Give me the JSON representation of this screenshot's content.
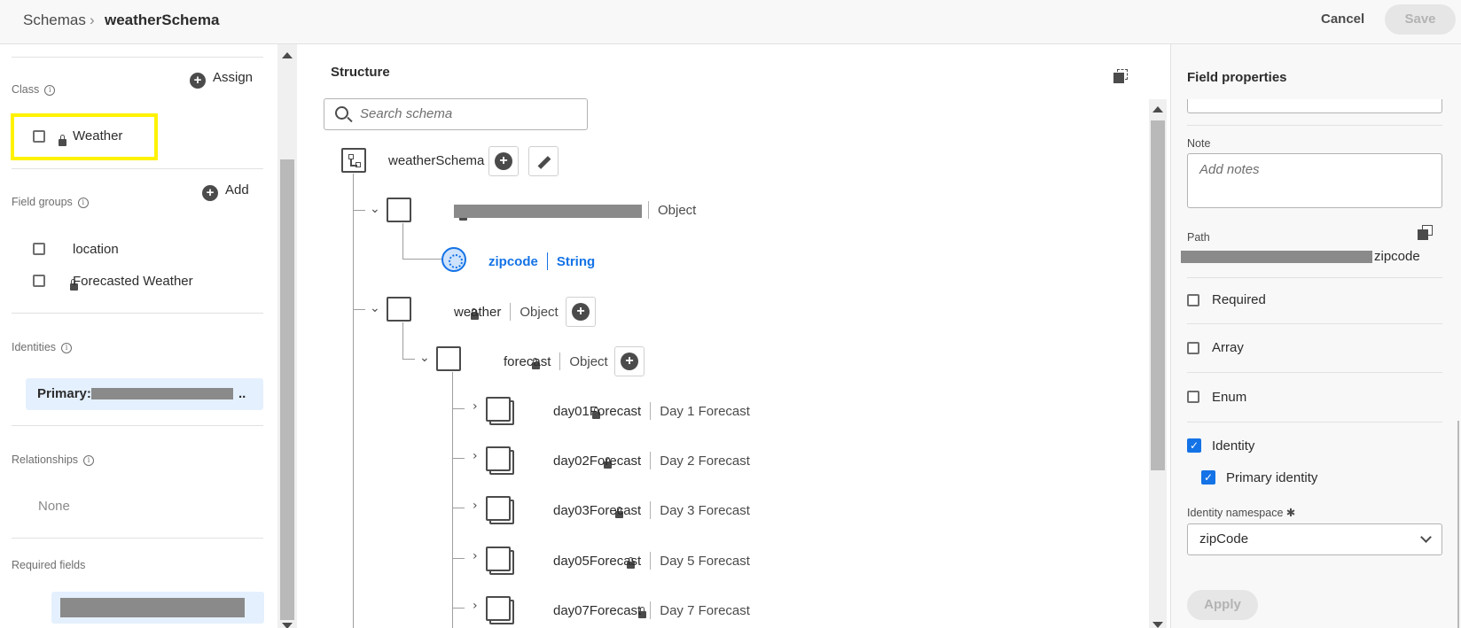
{
  "header": {
    "breadcrumb_root": "Schemas",
    "breadcrumb_separator": "›",
    "breadcrumb_current": "weatherSchema",
    "cancel_label": "Cancel",
    "save_label": "Save"
  },
  "left": {
    "class_label": "Class",
    "assign_label": "Assign",
    "class_item": "Weather",
    "field_groups_label": "Field groups",
    "add_label": "Add",
    "field_groups": [
      "location",
      "Forecasted Weather"
    ],
    "identities_label": "Identities",
    "identity_primary_prefix": "Primary:",
    "identity_suffix": "..",
    "relationships_label": "Relationships",
    "relationships_value": "None",
    "required_fields_label": "Required fields"
  },
  "structure": {
    "title": "Structure",
    "search_placeholder": "Search schema",
    "root": "weatherSchema",
    "obj1_type": "Object",
    "zipcode_name": "zipcode",
    "zipcode_type": "String",
    "weather_name": "weather",
    "weather_type": "Object",
    "forecast_name": "forecast",
    "forecast_type": "Object",
    "days": [
      {
        "name": "day01Forecast",
        "type": "Day 1 Forecast"
      },
      {
        "name": "day02Forecast",
        "type": "Day 2 Forecast"
      },
      {
        "name": "day03Forecast",
        "type": "Day 3 Forecast"
      },
      {
        "name": "day05Forecast",
        "type": "Day 5 Forecast"
      },
      {
        "name": "day07Forecast",
        "type": "Day 7 Forecast"
      }
    ]
  },
  "properties": {
    "title": "Field properties",
    "note_label": "Note",
    "note_placeholder": "Add notes",
    "path_label": "Path",
    "path_suffix": "zipcode",
    "required_label": "Required",
    "array_label": "Array",
    "enum_label": "Enum",
    "identity_label": "Identity",
    "primary_identity_label": "Primary identity",
    "namespace_label": "Identity namespace",
    "namespace_required_mark": "✱",
    "namespace_value": "zipCode",
    "apply_label": "Apply",
    "checked": {
      "required": false,
      "array": false,
      "enum": false,
      "identity": true,
      "primary_identity": true
    }
  },
  "colors": {
    "accent": "#1473e6",
    "highlight": "#fff200",
    "pill": "#e5f0fe"
  }
}
